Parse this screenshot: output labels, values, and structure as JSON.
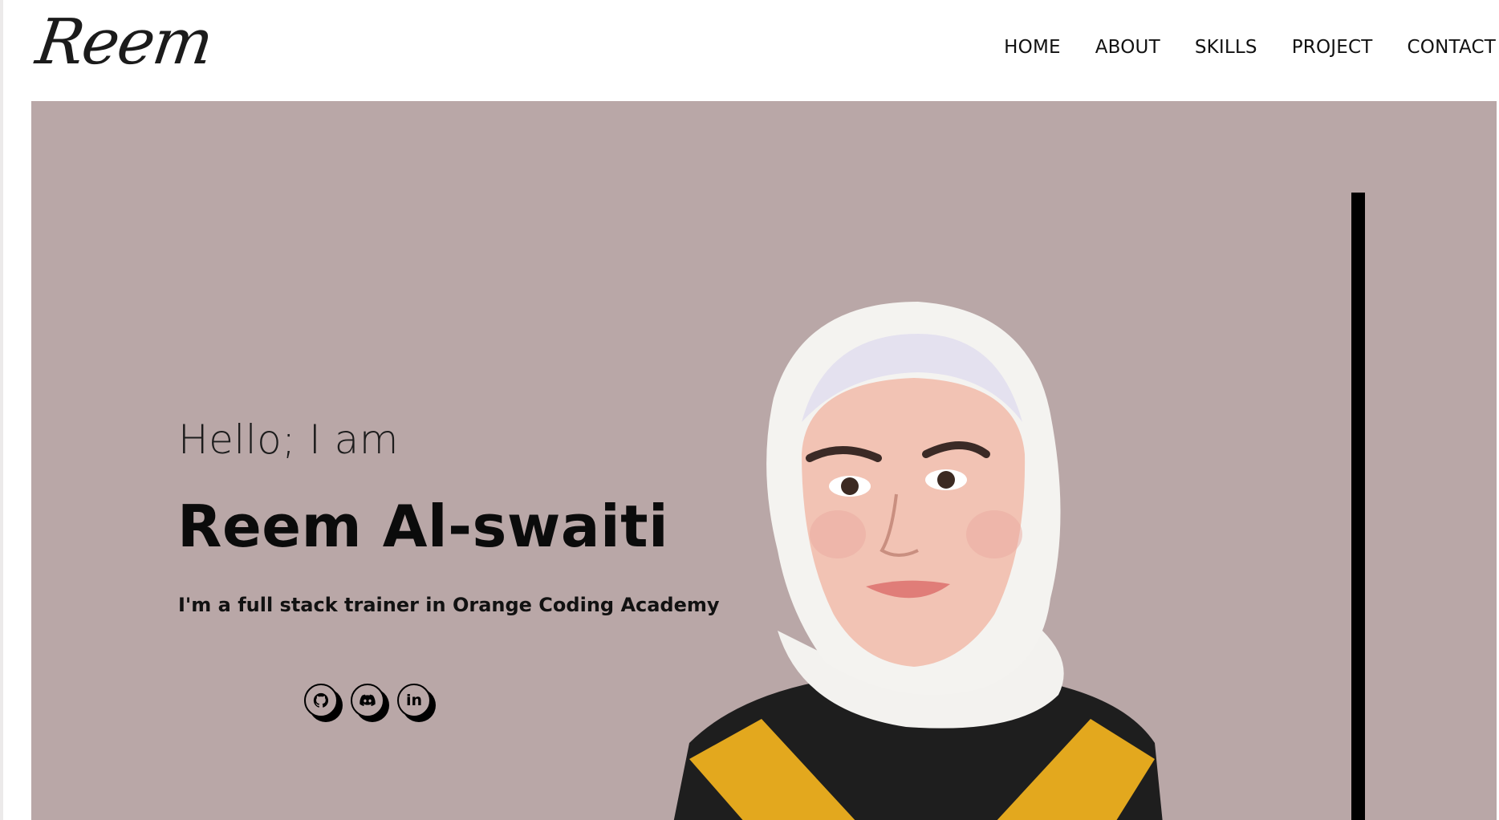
{
  "header": {
    "logo": "Reem",
    "nav": [
      "HOME",
      "ABOUT",
      "SKILLS",
      "PROJECT",
      "CONTACT"
    ]
  },
  "hero": {
    "greeting": "Hello; I am",
    "name": "Reem Al-swaiti",
    "tagline": "I'm a full stack trainer in Orange Coding Academy",
    "socials": [
      {
        "icon": "github-icon"
      },
      {
        "icon": "discord-icon"
      },
      {
        "icon": "linkedin-icon",
        "text": "in"
      }
    ]
  },
  "colors": {
    "hero_background": "#b9a7a7",
    "text": "#0b0b0b",
    "accent_line": "#000000"
  }
}
